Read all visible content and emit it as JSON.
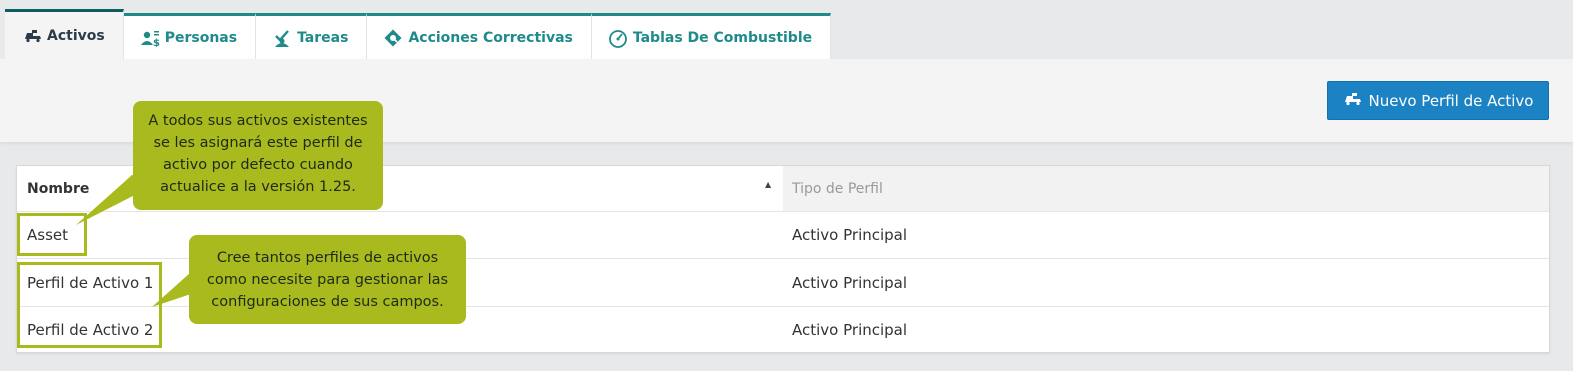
{
  "tabs": [
    {
      "label": "Activos",
      "icon": "truck-icon"
    },
    {
      "label": "Personas",
      "icon": "people-icon"
    },
    {
      "label": "Tareas",
      "icon": "tasks-icon"
    },
    {
      "label": "Acciones Correctivas",
      "icon": "wrench-icon"
    },
    {
      "label": "Tablas De Combustible",
      "icon": "gauge-icon"
    }
  ],
  "toolbar": {
    "new_button_label": "Nuevo Perfil de Activo"
  },
  "table": {
    "headers": {
      "name": "Nombre",
      "type": "Tipo de Perfil"
    },
    "rows": [
      {
        "name": "Asset",
        "type": "Activo Principal"
      },
      {
        "name": "Perfil de Activo 1",
        "type": "Activo Principal"
      },
      {
        "name": "Perfil de Activo 2",
        "type": "Activo Principal"
      }
    ]
  },
  "callouts": {
    "default_profile": "A todos sus activos existentes se les asignará este perfil de activo por defecto cuando actualice a la versión 1.25.",
    "create_profiles": "Cree tantos perfiles de activos como necesite para gestionar las configuraciones de sus campos."
  },
  "colors": {
    "accent": "#1e8a8a",
    "primary_button": "#1b83c4",
    "callout": "#a8ba1e"
  }
}
